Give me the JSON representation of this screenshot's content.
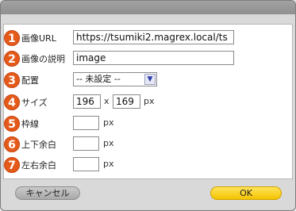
{
  "fields": [
    {
      "number": "1",
      "label": "画像URL",
      "value": "https://tsumiki2.magrex.local/ts"
    },
    {
      "number": "2",
      "label": "画像の説明",
      "value": "image"
    },
    {
      "number": "3",
      "label": "配置",
      "selected": "-- 未設定 --"
    },
    {
      "number": "4",
      "label": "サイズ",
      "width": "196",
      "separator": "x",
      "height": "169",
      "unit": "px"
    },
    {
      "number": "5",
      "label": "枠線",
      "value": "",
      "unit": "px"
    },
    {
      "number": "6",
      "label": "上下余白",
      "value": "",
      "unit": "px"
    },
    {
      "number": "7",
      "label": "左右余白",
      "value": "",
      "unit": "px"
    }
  ],
  "buttons": {
    "cancel": "キャンセル",
    "ok": "OK"
  },
  "colors": {
    "number_badge": "#e45a1a",
    "ok_button": "#f3c300"
  }
}
